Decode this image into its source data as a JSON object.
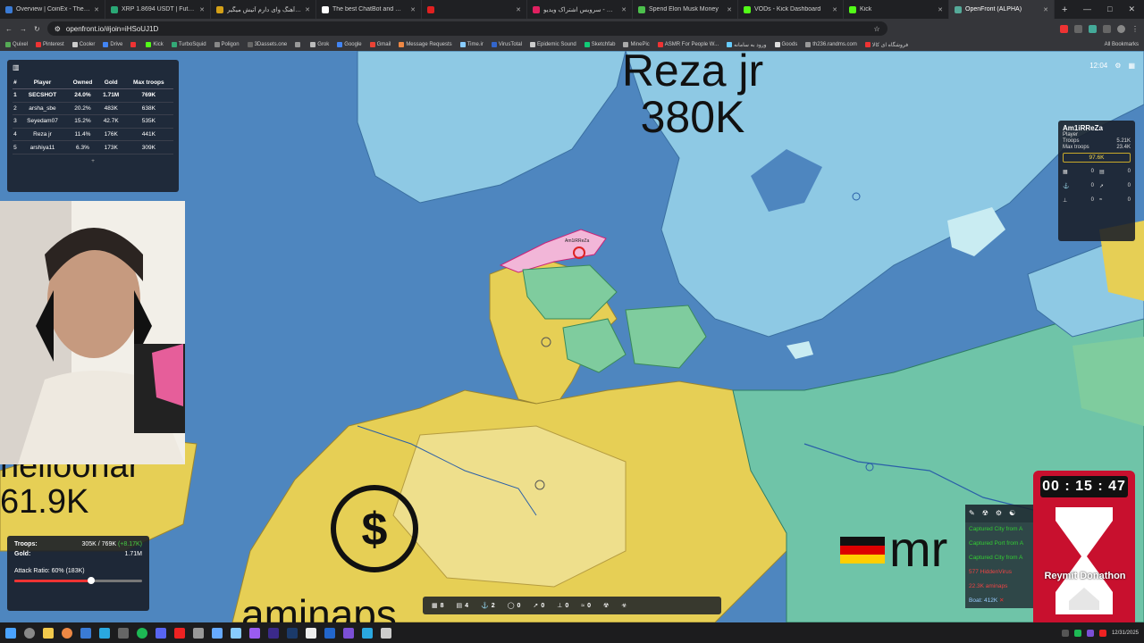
{
  "browser": {
    "tabs": [
      {
        "title": "Overview | CoinEx - The Global",
        "color": "#3a7bd5",
        "active": false
      },
      {
        "title": "XRP 1.8694 USDT | Futures Mar",
        "color": "#2aa876",
        "active": false
      },
      {
        "title": "دانلود آهنگ وای دارم آتیش میگیر",
        "color": "#d4a017",
        "active": false
      },
      {
        "title": "The best ChatBot and Widgets",
        "color": "#ffffff",
        "active": false
      },
      {
        "title": "",
        "color": "#e02020",
        "active": false
      },
      {
        "title": "آپارات - سرویس اشتراک ویدیو",
        "color": "#e02060",
        "active": false
      },
      {
        "title": "Spend Elon Musk Money",
        "color": "#4cc04c",
        "active": false
      },
      {
        "title": "VODs - Kick Dashboard",
        "color": "#53fc18",
        "active": false
      },
      {
        "title": "Kick",
        "color": "#53fc18",
        "active": false
      },
      {
        "title": "OpenFront (ALPHA)",
        "color": "#5a9",
        "active": true
      }
    ],
    "new_tab": "+",
    "url": "openfront.io/#join=iHSoUJ1D",
    "bookmarks": [
      "Quixel",
      "Pinterest",
      "Cooler",
      "Drive",
      "",
      "Kick",
      "TurboSquid",
      "Poligon",
      "3Dassets.one",
      "",
      "Grok",
      "Google",
      "Gmail",
      "Message Requests",
      "Time.ir",
      "VirusTotal",
      "Epidemic Sound",
      "Sketchfab",
      "MinePic",
      "ASMR For People W...",
      "ورود به سامانه",
      "Goods",
      "th236.randms.com",
      "فروشگاه ای کالا"
    ],
    "all_bookmarks": "All Bookmarks"
  },
  "leaderboard": {
    "columns": [
      "#",
      "Player",
      "Owned",
      "Gold",
      "Max troops"
    ],
    "rows": [
      [
        "1",
        "SECSHOT",
        "24.0%",
        "1.71M",
        "769K"
      ],
      [
        "2",
        "arsha_sbe",
        "20.2%",
        "483K",
        "638K"
      ],
      [
        "3",
        "Seyedam07",
        "15.2%",
        "42.7K",
        "535K"
      ],
      [
        "4",
        "Reza jr",
        "11.4%",
        "176K",
        "441K"
      ],
      [
        "5",
        "arshiya11",
        "6.3%",
        "173K",
        "309K"
      ]
    ],
    "expand": "+"
  },
  "map_labels": {
    "reza_name": "Reza jr",
    "reza_troops": "380K",
    "left_name": "helloonar",
    "left_troops": "61.9K",
    "bottom_name": "aminaps",
    "right_name": "mr",
    "small_city": "Am1iRReZa"
  },
  "clock": {
    "time": "12:04"
  },
  "player_panel": {
    "name": "Am1iRReZa",
    "type": "Player",
    "troops_label": "Troops",
    "troops": "5.21K",
    "max_label": "Max troops",
    "max": "23.4K",
    "gold": "97.6K",
    "counts": [
      "0",
      "0",
      "0",
      "0",
      "0",
      "0"
    ]
  },
  "stats": {
    "troops_label": "Troops:",
    "troops": "305K / 769K",
    "troops_delta": "(+8.17K)",
    "gold_label": "Gold:",
    "gold": "1.71M",
    "attack_label": "Attack Ratio: 60% (183K)",
    "attack_ratio": 0.6
  },
  "build_bar": {
    "counts": [
      "8",
      "4",
      "2",
      "0",
      "0",
      "0",
      "0"
    ]
  },
  "feed": {
    "messages": [
      "Captured City from A",
      "Captured Port from A",
      "Captured City from A",
      "577 HiddenVirus",
      "22.3K aminaps"
    ],
    "boat": "Boat: 412K",
    "retreat": "Ret"
  },
  "donation": {
    "timer": "00 : 15 : 47",
    "label": "Reymit Donathon"
  },
  "taskbar": {
    "date": "12/31/2025"
  }
}
